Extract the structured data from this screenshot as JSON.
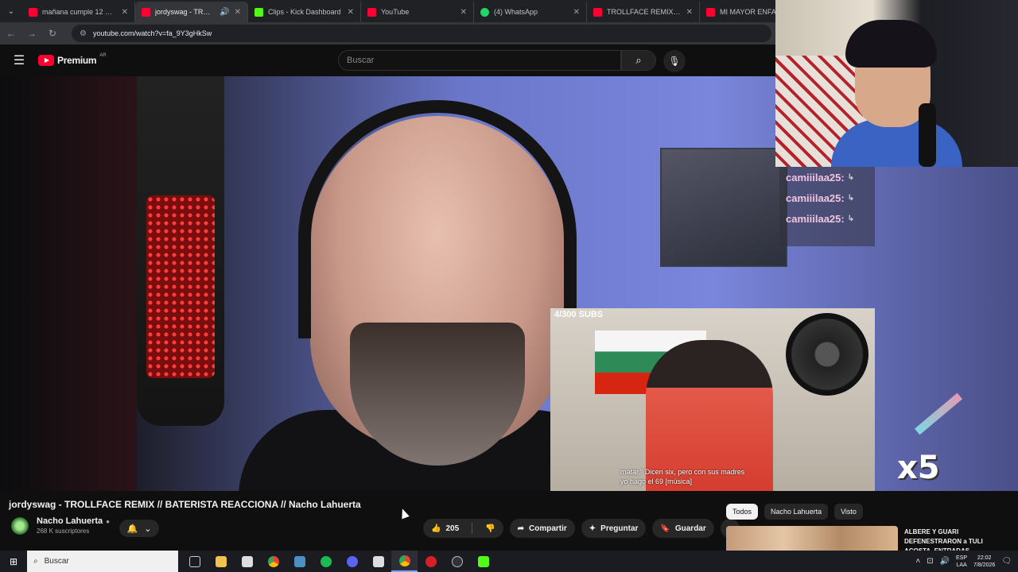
{
  "browser": {
    "tabs": [
      {
        "label": "mañana cumple 12 🎂 #1...",
        "favicon": "youtube-icon",
        "active": false
      },
      {
        "label": "jordyswag - TROLLFACE...",
        "favicon": "youtube-icon",
        "active": true
      },
      {
        "label": "Clips - Kick Dashboard",
        "favicon": "kick-icon",
        "active": false
      },
      {
        "label": "YouTube",
        "favicon": "youtube-icon",
        "active": false
      },
      {
        "label": "(4) WhatsApp",
        "favicon": "whatsapp-icon",
        "active": false
      },
      {
        "label": "TROLLFACE REMIX (docum...",
        "favicon": "youtube-icon",
        "active": false
      },
      {
        "label": "MI MAYOR ENFADO E...",
        "favicon": "youtube-icon",
        "active": false
      }
    ],
    "url": "youtube.com/watch?v=fa_9Y3gHkSw"
  },
  "youtube": {
    "brand": "Premium",
    "region": "AR",
    "search_placeholder": "Buscar",
    "video": {
      "overlay_subs": "4/300 SUBS",
      "caption_line1": "matar.\" Dicen six, pero con sus madres",
      "caption_line2": "yo hago el 69 [música]",
      "overlay_multiplier": "x5"
    },
    "chat": [
      {
        "user": "camiiilaa25:"
      },
      {
        "user": "camiiilaa25:"
      },
      {
        "user": "camiiilaa25:"
      }
    ],
    "title": "jordyswag - TROLLFACE REMIX // BATERISTA REACCIONA // Nacho Lahuerta",
    "channel": {
      "name": "Nacho Lahuerta",
      "subscribers": "268 K suscriptores"
    },
    "actions": {
      "likes": "205",
      "share": "Compartir",
      "ask": "Preguntar",
      "save": "Guardar"
    },
    "chips": [
      "Todos",
      "Nacho Lahuerta",
      "Visto"
    ],
    "recommendation": {
      "title": "ALBERE Y GUARI DEFENESTRARON a TULI ACOSTA, ENTRADAS..."
    }
  },
  "taskbar": {
    "search_placeholder": "Buscar",
    "lang_top": "ESP",
    "lang_bottom": "LAA",
    "time": "22:02",
    "date": "7/8/2026"
  },
  "colors": {
    "youtube_red": "#ff0033",
    "kick_green": "#53fc18",
    "chat_name": "#f3c4df"
  }
}
